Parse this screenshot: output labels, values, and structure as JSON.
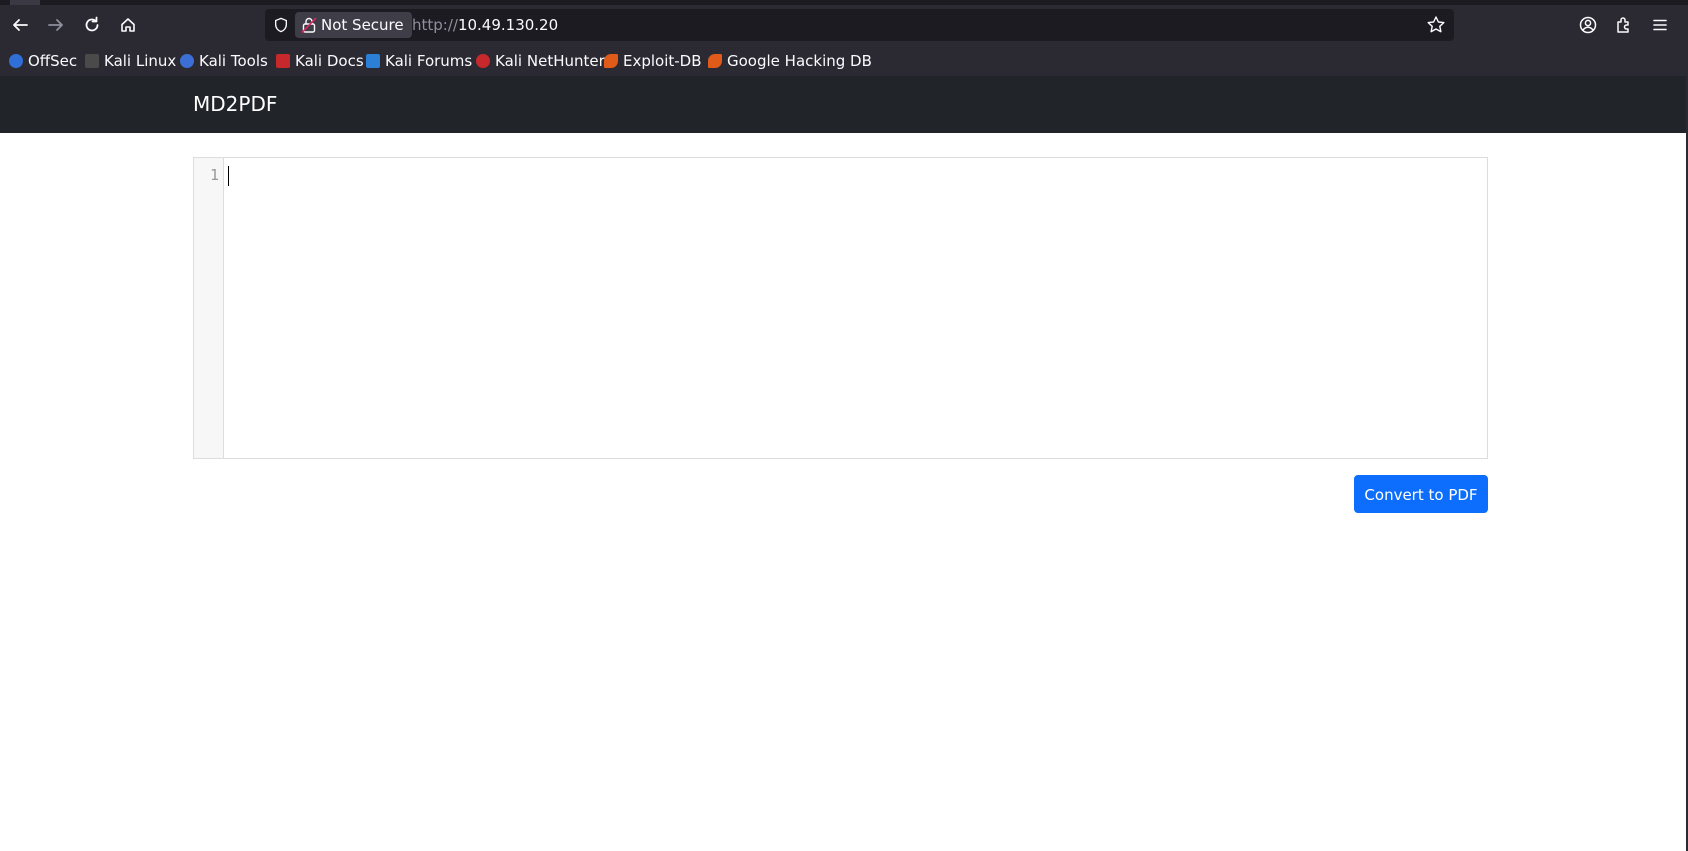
{
  "browser": {
    "not_secure_label": "Not Secure",
    "url_scheme": "http://",
    "url_host": "10.49.130.20",
    "bookmarks": [
      {
        "label": "OffSec",
        "color": "#2f6fd6"
      },
      {
        "label": "Kali Linux",
        "color": "#4a4a4a"
      },
      {
        "label": "Kali Tools",
        "color": "#3b6fd6"
      },
      {
        "label": "Kali Docs",
        "color": "#c7282b"
      },
      {
        "label": "Kali Forums",
        "color": "#2b7fd6"
      },
      {
        "label": "Kali NetHunter",
        "color": "#c7282b"
      },
      {
        "label": "Exploit-DB",
        "color": "#e05b1a"
      },
      {
        "label": "Google Hacking DB",
        "color": "#e05b1a"
      }
    ]
  },
  "page": {
    "brand": "MD2PDF",
    "editor": {
      "line_number": "1",
      "content": ""
    },
    "convert_button_label": "Convert to PDF"
  },
  "colors": {
    "chrome_bg": "#2b2a33",
    "navbar_bg": "#212529",
    "primary": "#0d6efd"
  }
}
